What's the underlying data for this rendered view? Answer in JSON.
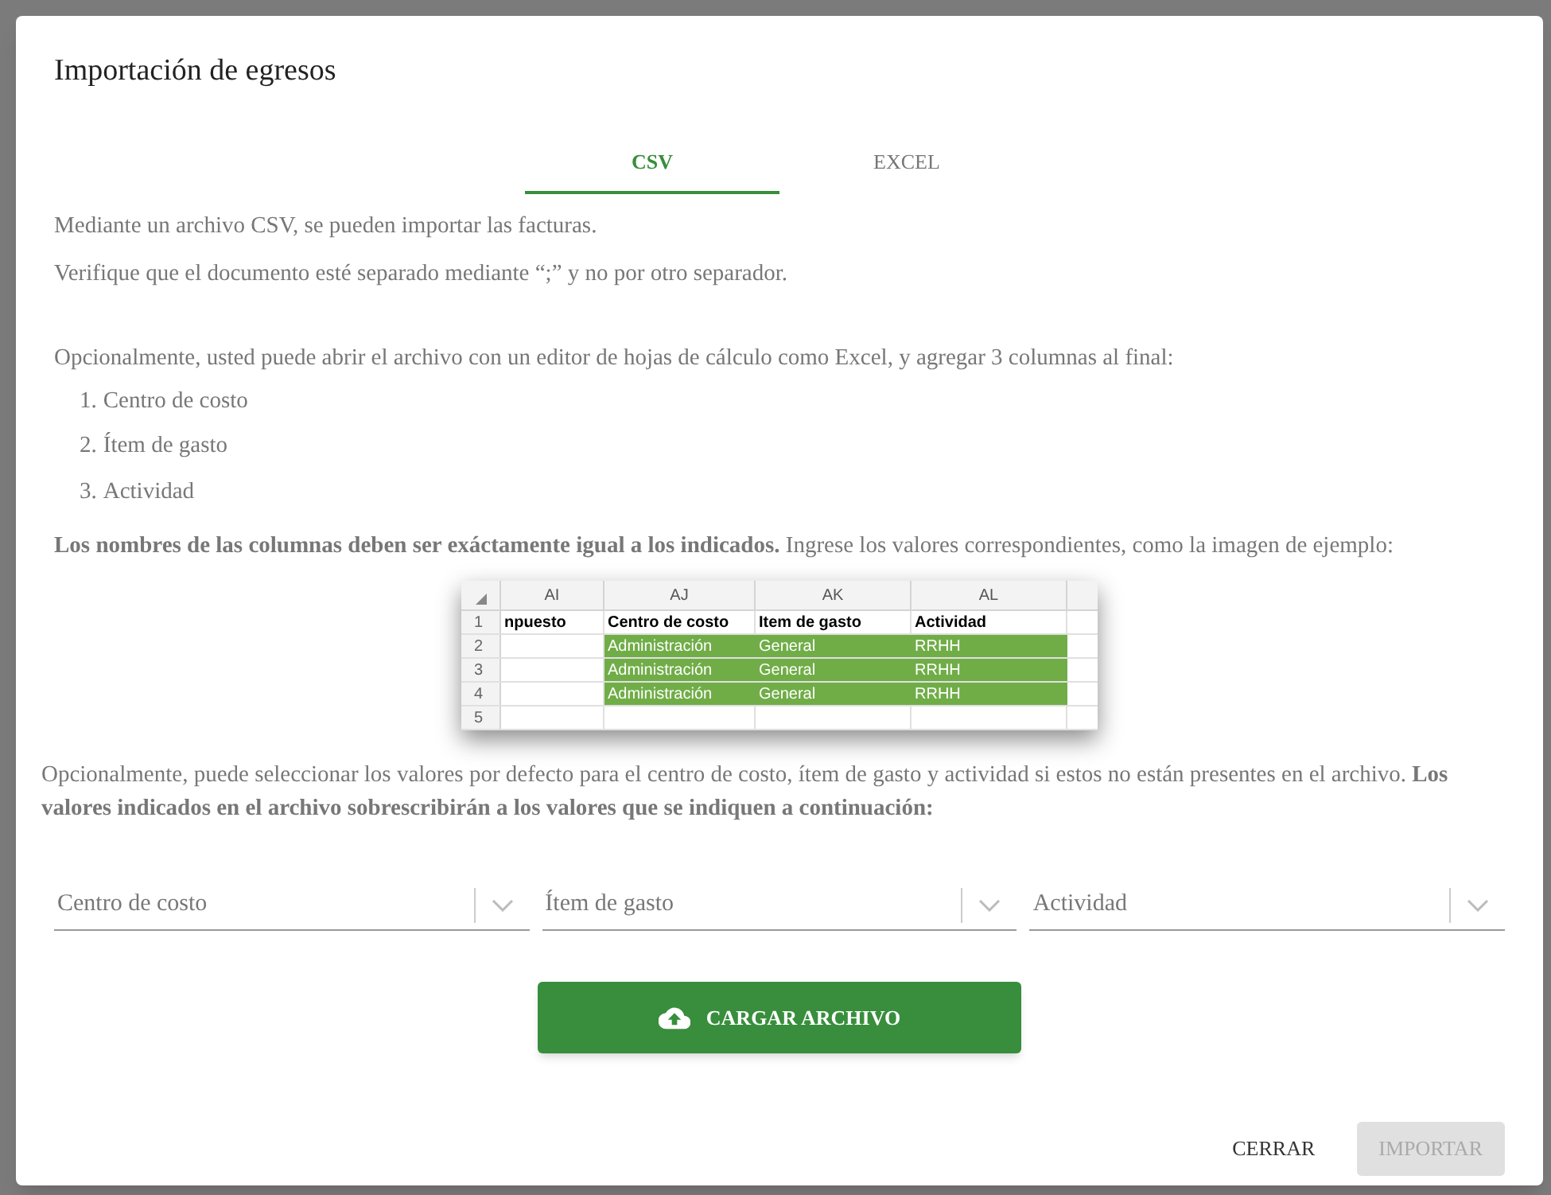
{
  "dialog": {
    "title": "Importación de egresos"
  },
  "tabs": [
    {
      "label": "CSV",
      "selected": true
    },
    {
      "label": "EXCEL",
      "selected": false
    }
  ],
  "intro": [
    "Mediante un archivo CSV, se pueden importar las facturas.",
    "Verifique que el documento esté separado mediante “;” y no por otro separador."
  ],
  "optional_note": "Opcionalmente, usted puede abrir el archivo con un editor de hojas de cálculo como Excel, y agregar 3 columnas al final:",
  "columns_list": [
    {
      "number": "1.",
      "text": "Centro de costo"
    },
    {
      "number": "2.",
      "text": "Ítem de gasto"
    },
    {
      "number": "3.",
      "text": "Actividad"
    }
  ],
  "names_note": "**Los nombres de las columnas deben ser exáctamente igual a los indicados.** Ingrese los valores correspondientes, como la imagen de ejemplo:",
  "spreadsheet": {
    "columns": [
      "AI",
      "AJ",
      "AK",
      "AL"
    ],
    "rows": [
      {
        "number": "1",
        "kind": "header",
        "cells": [
          {
            "text": "npuesto",
            "highlighted": false
          },
          {
            "text": "Centro de costo",
            "highlighted": false
          },
          {
            "text": "Item de gasto",
            "highlighted": false
          },
          {
            "text": "Actividad",
            "highlighted": false
          }
        ]
      },
      {
        "number": "2",
        "kind": "data",
        "cells": [
          {
            "highlighted": false
          },
          {
            "text": "Administración",
            "highlighted": true
          },
          {
            "text": "General",
            "highlighted": true
          },
          {
            "text": "RRHH",
            "highlighted": true
          }
        ]
      },
      {
        "number": "3",
        "kind": "data",
        "cells": [
          {
            "highlighted": false
          },
          {
            "text": "Administración",
            "highlighted": true
          },
          {
            "text": "General",
            "highlighted": true
          },
          {
            "text": "RRHH",
            "highlighted": true
          }
        ]
      },
      {
        "number": "4",
        "kind": "data",
        "cells": [
          {
            "highlighted": false
          },
          {
            "text": "Administración",
            "highlighted": true
          },
          {
            "text": "General",
            "highlighted": true
          },
          {
            "text": "RRHH",
            "highlighted": true
          }
        ]
      },
      {
        "number": "5",
        "kind": "data",
        "cells": [
          {
            "highlighted": false
          },
          {
            "highlighted": false
          },
          {
            "highlighted": false
          },
          {
            "highlighted": false
          }
        ]
      }
    ]
  },
  "defaults_note": "Opcionalmente, puede seleccionar los valores por defecto para el centro de costo, ítem de gasto y actividad si estos no están presentes en el archivo. **Los valores indicados en el archivo sobrescribirán a los valores que se indiquen a continuación:**",
  "selects": [
    {
      "placeholder": "Centro de costo"
    },
    {
      "placeholder": "Ítem de gasto"
    },
    {
      "placeholder": "Actividad"
    }
  ],
  "upload_button": "CARGAR ARCHIVO",
  "actions": [
    {
      "label": "CERRAR",
      "kind": "text",
      "disabled": false
    },
    {
      "label": "IMPORTAR",
      "kind": "contained",
      "disabled": true
    }
  ]
}
